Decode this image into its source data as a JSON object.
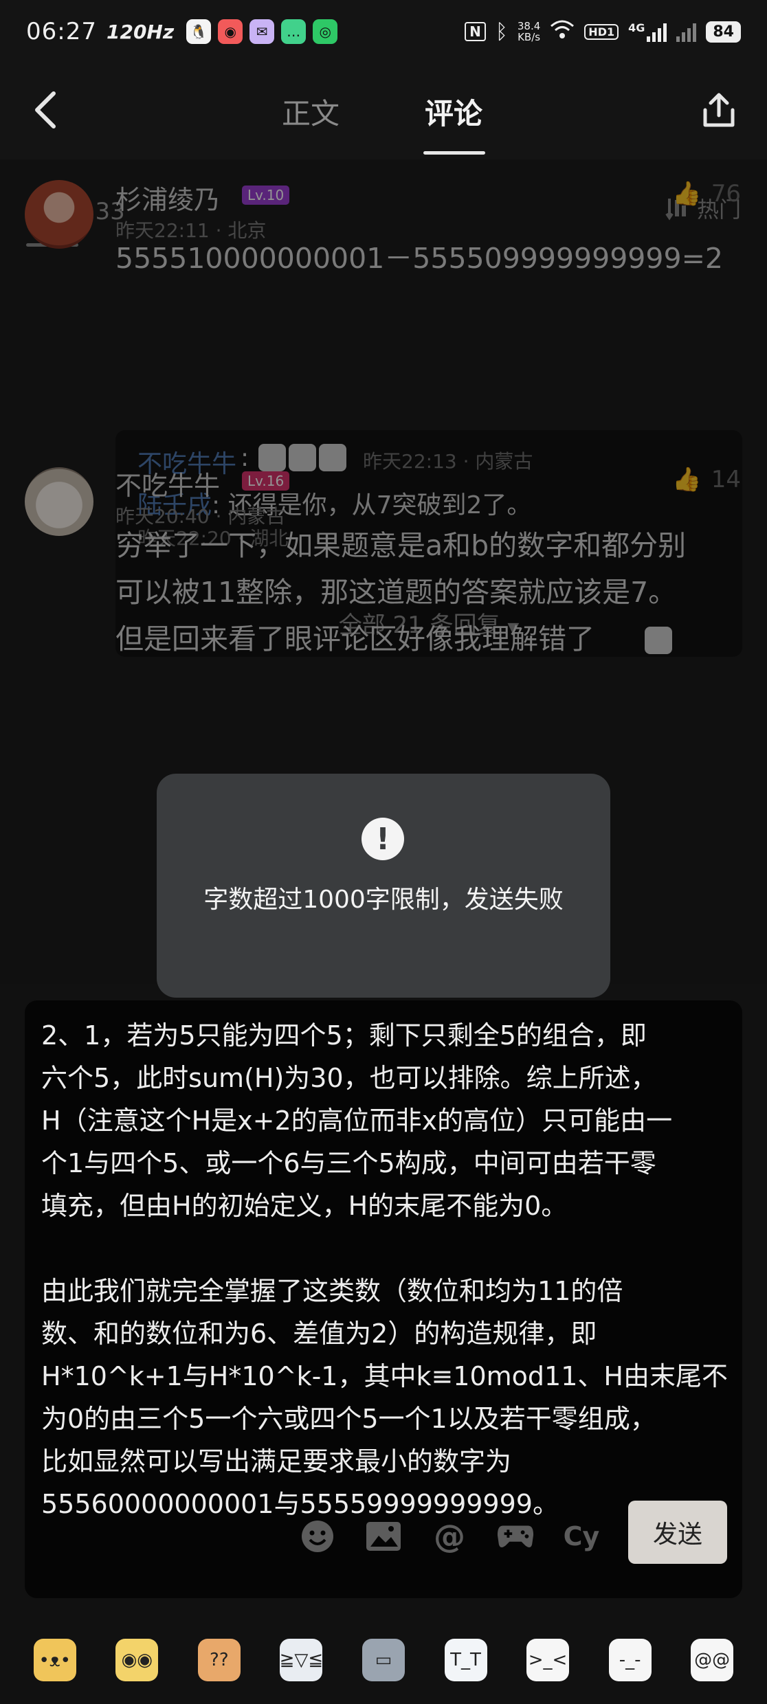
{
  "status_bar": {
    "time": "06:27",
    "refresh": "120Hz",
    "net_speed_value": "38.4",
    "net_speed_unit": "KB/s",
    "hd_label": "HD1",
    "network_label": "4G",
    "battery": "84",
    "app_icons": [
      "qq-icon",
      "app-icon",
      "mail-icon",
      "message-icon",
      "wechat-icon"
    ]
  },
  "header": {
    "tabs": [
      {
        "label": "正文",
        "active": false
      },
      {
        "label": "评论",
        "active": true
      }
    ]
  },
  "comments_header": {
    "label": "评论",
    "count": "133",
    "sort_label": "热门"
  },
  "comments": [
    {
      "user": "杉浦绫乃",
      "level": "Lv.10",
      "level_color": "#9a3fd0",
      "time_location": "昨天22:11 · 北京",
      "likes": "76",
      "text": "555510000000001－555509999999999=2",
      "replies": [
        {
          "name": "不吃牛牛",
          "sep": ":",
          "meta": "昨天22:13 · 内蒙古"
        },
        {
          "name": "陆壬戌",
          "text": ": 还得是你，从7突破到2了。",
          "meta": "昨天22:20 · 湖北"
        }
      ],
      "all_replies": "全部 21 条回复"
    },
    {
      "user": "不吃牛牛",
      "level": "Lv.16",
      "level_color": "#d6336c",
      "time_location": "昨天20:40 · 内蒙古",
      "likes": "14",
      "text_lines": [
        "穷举了一下，如果题意是a和b的数字和都分别",
        "可以被11整除，那这道题的答案就应该是7。",
        "但是回来看了眼评论区好像我理解错了"
      ]
    }
  ],
  "toast": {
    "icon": "!",
    "message": "字数超过1000字限制，发送失败"
  },
  "editor": {
    "paragraph1_lines": [
      "2、1，若为5只能为四个5；剩下只剩全5的组合，即",
      "六个5，此时sum(H)为30，也可以排除。综上所述，",
      "H（注意这个H是x+2的高位而非x的高位）只可能由一",
      "个1与四个5、或一个6与三个5构成，中间可由若干零",
      "填充，但由H的初始定义，H的末尾不能为0。"
    ],
    "paragraph2_lines": [
      "由此我们就完全掌握了这类数（数位和均为11的倍",
      "数、和的数位和为6、差值为2）的构造规律，即",
      "H*10^k+1与H*10^k-1，其中k≡10mod11、H由末尾不",
      "为0的由三个5一个六或四个5一个1以及若干零组成，",
      "比如显然可以写出满足要求最小的数字为",
      "55560000000001与55559999999999。"
    ],
    "send_label": "发送",
    "tools": [
      "emoji-icon",
      "image-icon",
      "at-icon",
      "game-icon",
      "cy-icon"
    ]
  },
  "emoji_strip": [
    "dog-emoji",
    "chick-emoji",
    "puzzled-emoji",
    "laugh-cry-emoji",
    "helmet-emoji",
    "cry-emoji",
    "rainbow-emoji",
    "sweat-emoji",
    "dizzy-emoji"
  ]
}
